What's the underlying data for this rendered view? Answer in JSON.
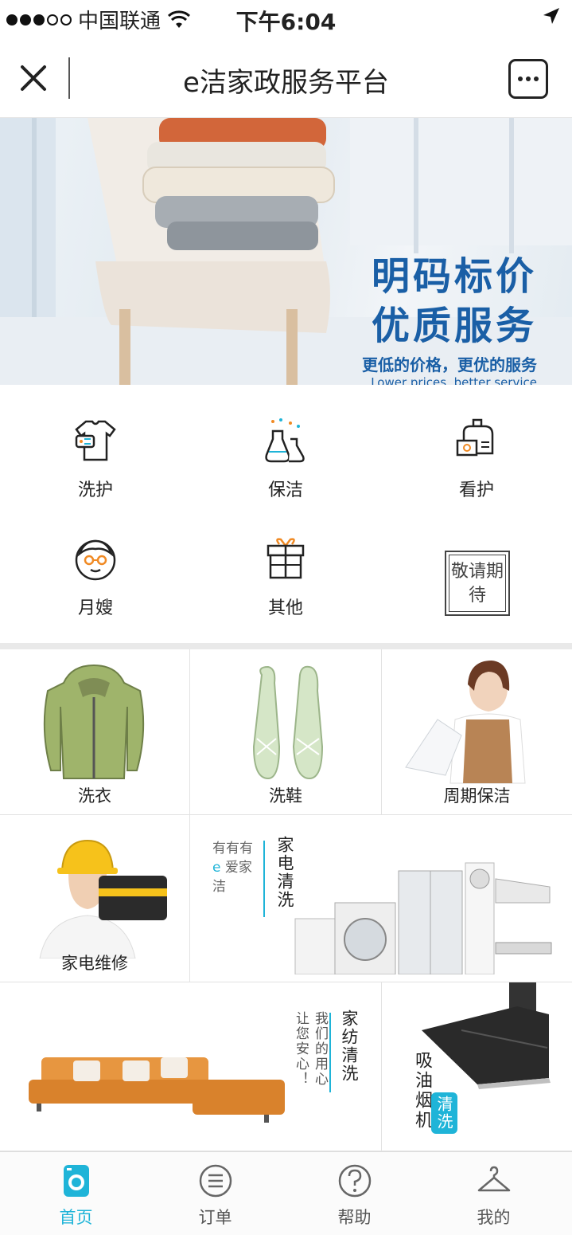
{
  "status_bar": {
    "carrier": "中国联通",
    "time": "下午6:04"
  },
  "nav": {
    "title": "e洁家政服务平台"
  },
  "banner": {
    "line1": "明码标价",
    "line2": "优质服务",
    "line3": "更低的价格，更优的服务",
    "line4": "Lower prices, better service"
  },
  "services": [
    {
      "label": "洗护",
      "icon": "tshirt-icon"
    },
    {
      "label": "保洁",
      "icon": "flask-icon"
    },
    {
      "label": "看护",
      "icon": "nursing-icon"
    },
    {
      "label": "月嫂",
      "icon": "nanny-icon"
    },
    {
      "label": "其他",
      "icon": "gift-box-icon"
    }
  ],
  "coming_soon": "敬请期待",
  "products": {
    "laundry": "洗衣",
    "shoes": "洗鞋",
    "periodic": "周期保洁",
    "repair": "家电维修",
    "appliance_title": "家电清洗",
    "appliance_slogan_1": "有有有",
    "appliance_slogan_2a": "e",
    "appliance_slogan_2b": "爱家",
    "appliance_slogan_3": "洁",
    "textile_title": "家纺清洗",
    "textile_slogan_a": "让您安心！",
    "textile_slogan_b": "我们的用心",
    "hood_title": "吸油烟机",
    "hood_tag": "清洗"
  },
  "tabs": [
    {
      "label": "首页",
      "active": true
    },
    {
      "label": "订单",
      "active": false
    },
    {
      "label": "帮助",
      "active": false
    },
    {
      "label": "我的",
      "active": false
    }
  ],
  "colors": {
    "accent": "#1fb4d8",
    "banner_blue": "#1a5fa6"
  }
}
